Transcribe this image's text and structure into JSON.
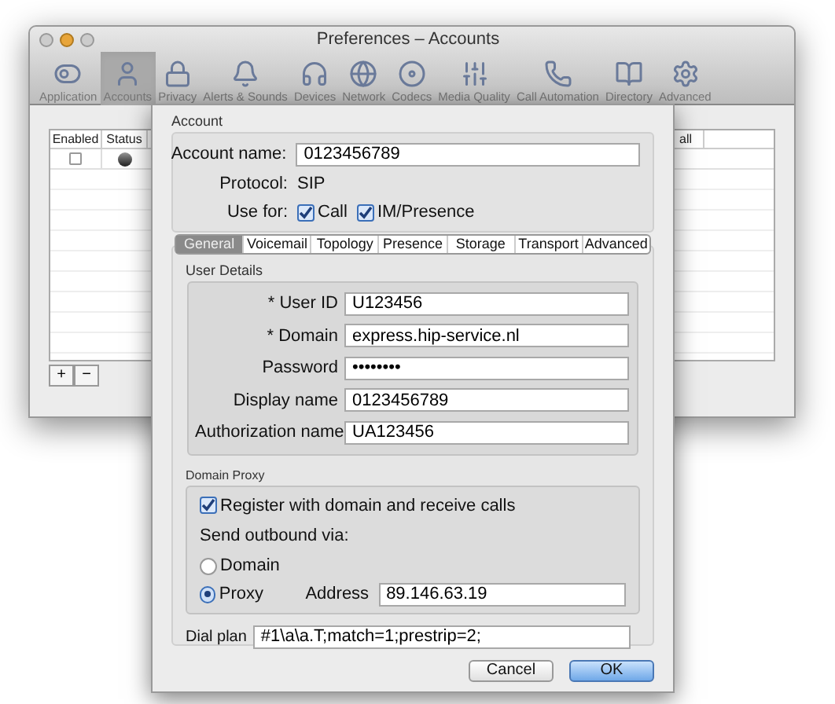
{
  "window": {
    "title": "Preferences – Accounts"
  },
  "toolbar": [
    {
      "label": "Application",
      "selected": false
    },
    {
      "label": "Accounts",
      "selected": true
    },
    {
      "label": "Privacy",
      "selected": false
    },
    {
      "label": "Alerts & Sounds",
      "selected": false
    },
    {
      "label": "Devices",
      "selected": false
    },
    {
      "label": "Network",
      "selected": false
    },
    {
      "label": "Codecs",
      "selected": false
    },
    {
      "label": "Media Quality",
      "selected": false
    },
    {
      "label": "Call Automation",
      "selected": false
    },
    {
      "label": "Directory",
      "selected": false
    },
    {
      "label": "Advanced",
      "selected": false
    }
  ],
  "table": {
    "columns": [
      "Enabled",
      "Status",
      "all"
    ],
    "rows": [
      {
        "enabled": false
      }
    ]
  },
  "table_buttons": [
    "+",
    "−"
  ],
  "sheet": {
    "account": {
      "title": "Account",
      "account_name": {
        "label": "Account name:",
        "value": "0123456789"
      },
      "protocol": {
        "label": "Protocol:",
        "value": "SIP"
      },
      "use_for": {
        "label": "Use for:",
        "options": [
          {
            "label": "Call",
            "checked": true
          },
          {
            "label": "IM/Presence",
            "checked": true
          }
        ]
      }
    },
    "tabs": [
      {
        "label": "General",
        "selected": true
      },
      {
        "label": "Voicemail",
        "selected": false
      },
      {
        "label": "Topology",
        "selected": false
      },
      {
        "label": "Presence",
        "selected": false
      },
      {
        "label": "Storage",
        "selected": false
      },
      {
        "label": "Transport",
        "selected": false
      },
      {
        "label": "Advanced",
        "selected": false
      }
    ],
    "user_details": {
      "title": "User Details",
      "fields": [
        {
          "label": "* User ID",
          "value": "U123456"
        },
        {
          "label": "* Domain",
          "value": "express.hip-service.nl"
        },
        {
          "label": "Password",
          "value": "••••••••"
        },
        {
          "label": "Display name",
          "value": "0123456789"
        },
        {
          "label": "Authorization name",
          "value": "UA123456"
        }
      ]
    },
    "domain_proxy": {
      "title": "Domain Proxy",
      "register": {
        "label": "Register with domain and receive calls",
        "checked": true
      },
      "send_label": "Send outbound via:",
      "options": [
        {
          "label": "Domain",
          "selected": false
        },
        {
          "label": "Proxy",
          "selected": true
        }
      ],
      "address": {
        "label": "Address",
        "value": "89.146.63.19"
      }
    },
    "dial_plan": {
      "label": "Dial plan",
      "value": "#1\\a\\a.T;match=1;prestrip=2;"
    },
    "buttons": [
      {
        "label": "Cancel",
        "kind": "normal"
      },
      {
        "label": "OK",
        "kind": "default"
      }
    ]
  }
}
